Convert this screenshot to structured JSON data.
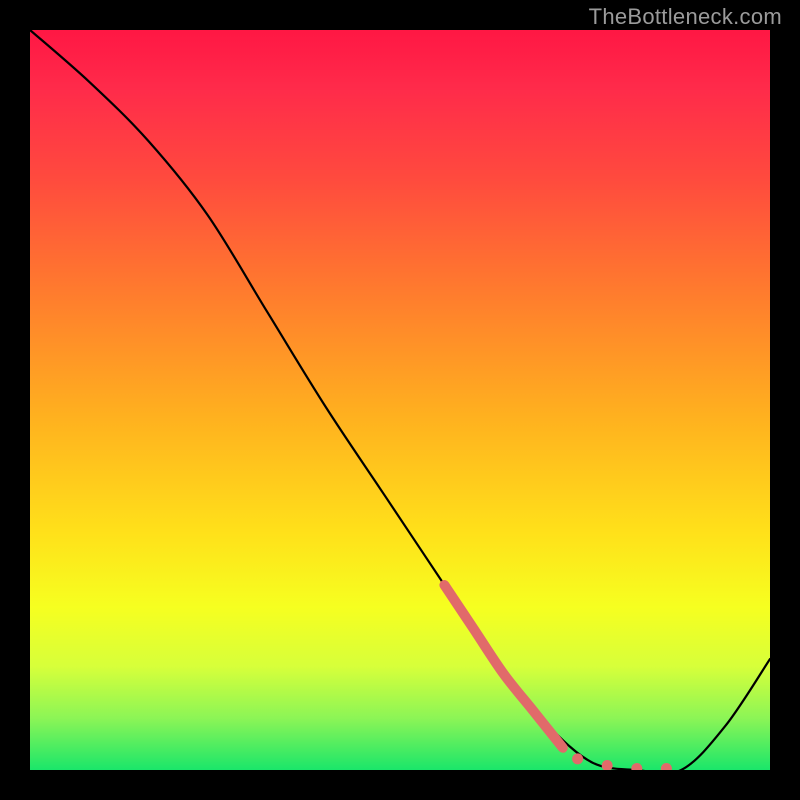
{
  "watermark": "TheBottleneck.com",
  "chart_data": {
    "type": "line",
    "title": "",
    "xlabel": "",
    "ylabel": "",
    "xlim": [
      0,
      100
    ],
    "ylim": [
      0,
      100
    ],
    "series": [
      {
        "name": "curve",
        "x": [
          0,
          8,
          16,
          24,
          32,
          40,
          48,
          56,
          64,
          70,
          76,
          82,
          88,
          94,
          100
        ],
        "y": [
          100,
          93,
          85,
          75,
          62,
          49,
          37,
          25,
          13,
          6,
          1,
          0,
          0,
          6,
          15
        ]
      }
    ],
    "highlight_segment": {
      "comment": "thick salmon stroke along the steep descent near the valley",
      "x": [
        56,
        60,
        64,
        68,
        72
      ],
      "y": [
        25,
        19,
        13,
        8,
        3
      ]
    },
    "highlight_dots": {
      "comment": "salmon dots along the valley floor",
      "x": [
        74,
        78,
        82,
        86
      ],
      "y": [
        1.5,
        0.6,
        0.2,
        0.2
      ]
    },
    "gradient_stops": [
      {
        "pos": 0,
        "color": "#ff1744"
      },
      {
        "pos": 8,
        "color": "#ff2b4a"
      },
      {
        "pos": 20,
        "color": "#ff4a3e"
      },
      {
        "pos": 35,
        "color": "#ff7a2e"
      },
      {
        "pos": 52,
        "color": "#ffb01f"
      },
      {
        "pos": 68,
        "color": "#ffe11a"
      },
      {
        "pos": 78,
        "color": "#f6ff20"
      },
      {
        "pos": 86,
        "color": "#d7ff3a"
      },
      {
        "pos": 93,
        "color": "#8cf556"
      },
      {
        "pos": 100,
        "color": "#1ae66a"
      }
    ],
    "colors": {
      "curve": "#000000",
      "highlight": "#e16a6a",
      "background_frame": "#000000",
      "watermark": "#9b9b9b"
    }
  }
}
